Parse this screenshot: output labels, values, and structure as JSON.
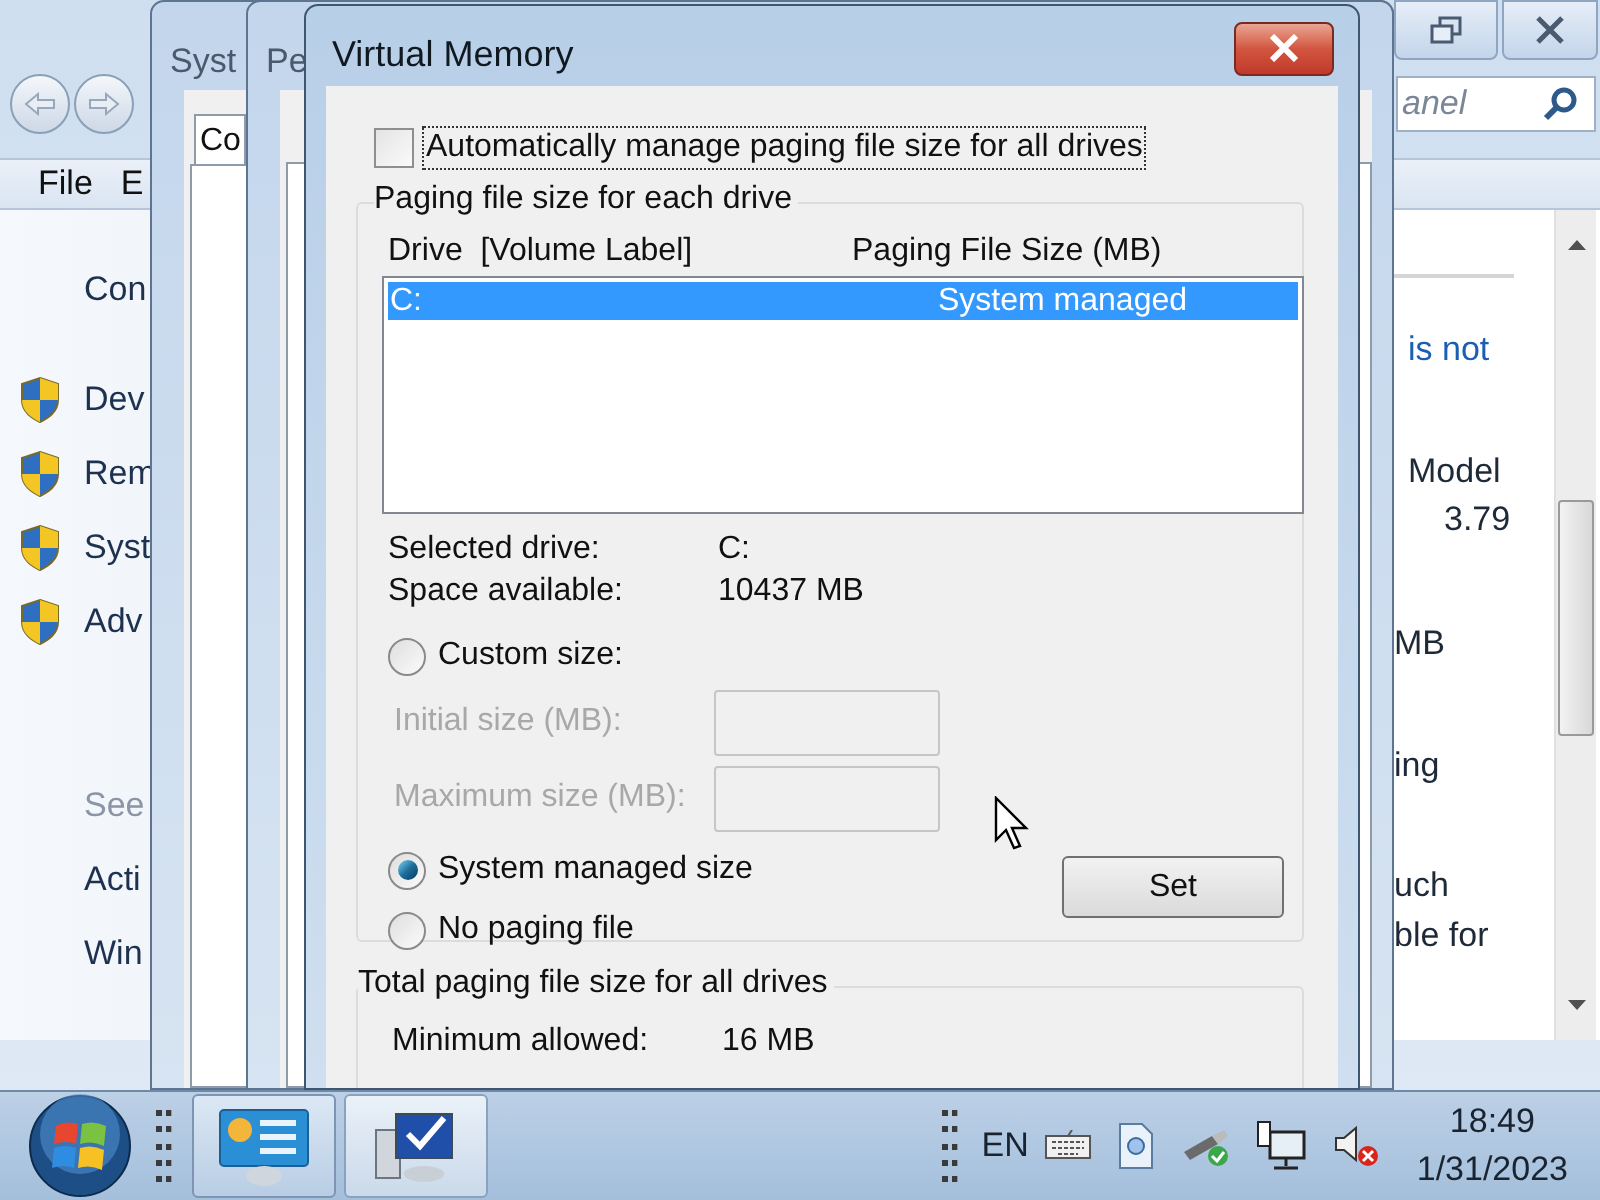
{
  "background_window": {
    "search_placeholder": "anel",
    "menu": [
      "File",
      "E"
    ],
    "left_pane": [
      {
        "label": "Con",
        "kind": "heading"
      },
      {
        "label": "Dev",
        "kind": "shield"
      },
      {
        "label": "Rem",
        "kind": "shield"
      },
      {
        "label": "Syst",
        "kind": "shield"
      },
      {
        "label": "Adv",
        "kind": "shield"
      },
      {
        "label": "See",
        "kind": "muted"
      },
      {
        "label": "Acti",
        "kind": "link"
      },
      {
        "label": "Win",
        "kind": "link"
      }
    ],
    "right_pane": [
      {
        "text": "is not",
        "kind": "link"
      },
      {
        "text": "Model",
        "kind": "text"
      },
      {
        "text": "3.79",
        "kind": "text"
      },
      {
        "text": "MB",
        "kind": "text"
      },
      {
        "text": "ing",
        "kind": "text"
      },
      {
        "text": "uch",
        "kind": "text"
      },
      {
        "text": "ble for",
        "kind": "text"
      }
    ]
  },
  "system_properties": {
    "title": "Syst",
    "tab": "Co"
  },
  "performance_options": {
    "title": "Pe"
  },
  "dialog": {
    "title": "Virtual Memory",
    "auto_manage": {
      "label": "Automatically manage paging file size for all drives",
      "checked": false
    },
    "drives_group": {
      "title": "Paging file size for each drive",
      "columns": [
        "Drive  [Volume Label]",
        "Paging File Size (MB)"
      ],
      "rows": [
        {
          "drive": "C:",
          "size": "System managed",
          "selected": true
        }
      ],
      "info": [
        {
          "label": "Selected drive:",
          "value": "C:"
        },
        {
          "label": "Space available:",
          "value": "10437 MB"
        }
      ],
      "options": [
        {
          "kind": "radio",
          "label": "Custom size:",
          "selected": false
        },
        {
          "kind": "field",
          "label": "Initial size (MB):",
          "disabled": true
        },
        {
          "kind": "field",
          "label": "Maximum size (MB):",
          "disabled": true
        },
        {
          "kind": "radio",
          "label": "System managed size",
          "selected": true
        },
        {
          "kind": "radio",
          "label": "No paging file",
          "selected": false
        }
      ],
      "set_button": "Set"
    },
    "total_group": {
      "title": "Total paging file size for all drives",
      "info": [
        {
          "label": "Minimum allowed:",
          "value": "16 MB"
        }
      ]
    }
  },
  "taskbar": {
    "language": "EN",
    "time": "18:49",
    "date": "1/31/2023"
  }
}
